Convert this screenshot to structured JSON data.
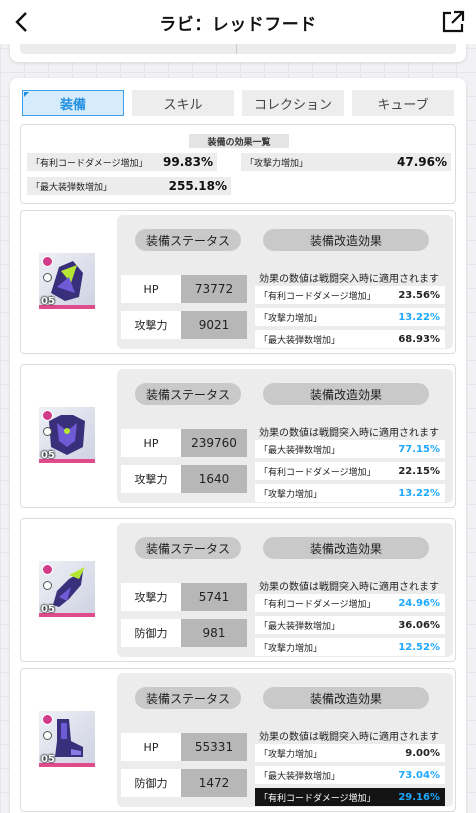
{
  "header": {
    "title": "ラビ：レッドフード"
  },
  "tabs": [
    {
      "label": "装備",
      "active": true
    },
    {
      "label": "スキル",
      "active": false
    },
    {
      "label": "コレクション",
      "active": false
    },
    {
      "label": "キューブ",
      "active": false
    }
  ],
  "summary": {
    "title": "装備の効果一覧",
    "items": [
      {
        "label": "「有利コードダメージ増加」",
        "value": "99.83%"
      },
      {
        "label": "「攻撃力増加」",
        "value": "47.96%"
      },
      {
        "label": "「最大装弾数増加」",
        "value": "255.18%"
      }
    ]
  },
  "status_label": "装備ステータス",
  "mod_label": "装備改造効果",
  "effect_note": "効果の数値は戦闘突入時に適用されます",
  "equipment": [
    {
      "level": "05",
      "icon": "helmet-icon",
      "stats": [
        {
          "label": "HP",
          "value": "73772"
        },
        {
          "label": "攻撃力",
          "value": "9021"
        }
      ],
      "effects": [
        {
          "label": "「有利コードダメージ増加」",
          "value": "23.56%",
          "highlight": false,
          "dark": false
        },
        {
          "label": "「攻撃力増加」",
          "value": "13.22%",
          "highlight": true,
          "dark": false
        },
        {
          "label": "「最大装弾数増加」",
          "value": "68.93%",
          "highlight": false,
          "dark": false
        }
      ]
    },
    {
      "level": "05",
      "icon": "armor-icon",
      "stats": [
        {
          "label": "HP",
          "value": "239760"
        },
        {
          "label": "攻撃力",
          "value": "1640"
        }
      ],
      "effects": [
        {
          "label": "「最大装弾数増加」",
          "value": "77.15%",
          "highlight": true,
          "dark": false
        },
        {
          "label": "「有利コードダメージ増加」",
          "value": "22.15%",
          "highlight": false,
          "dark": false
        },
        {
          "label": "「攻撃力増加」",
          "value": "13.22%",
          "highlight": true,
          "dark": false
        }
      ]
    },
    {
      "level": "05",
      "icon": "gauntlet-icon",
      "stats": [
        {
          "label": "攻撃力",
          "value": "5741"
        },
        {
          "label": "防御力",
          "value": "981"
        }
      ],
      "effects": [
        {
          "label": "「有利コードダメージ増加」",
          "value": "24.96%",
          "highlight": true,
          "dark": false
        },
        {
          "label": "「最大装弾数増加」",
          "value": "36.06%",
          "highlight": false,
          "dark": false
        },
        {
          "label": "「攻撃力増加」",
          "value": "12.52%",
          "highlight": true,
          "dark": false
        }
      ]
    },
    {
      "level": "05",
      "icon": "boots-icon",
      "stats": [
        {
          "label": "HP",
          "value": "55331"
        },
        {
          "label": "防御力",
          "value": "1472"
        }
      ],
      "effects": [
        {
          "label": "「攻撃力増加」",
          "value": "9.00%",
          "highlight": false,
          "dark": false
        },
        {
          "label": "「最大装弾数増加」",
          "value": "73.04%",
          "highlight": true,
          "dark": false
        },
        {
          "label": "「有利コードダメージ増加」",
          "value": "29.16%",
          "highlight": true,
          "dark": true
        }
      ]
    }
  ],
  "colors": {
    "accent": "#1f8fe0",
    "highlight_value": "#1fa8ff",
    "rarity_bar": "#e04b8c"
  }
}
